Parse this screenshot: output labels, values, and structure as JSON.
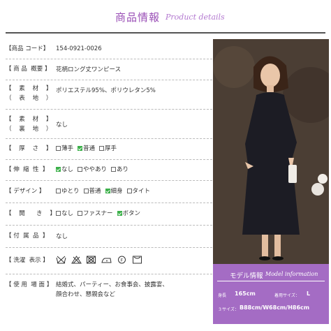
{
  "header": {
    "title": "商品情報",
    "subtitle": "Product details"
  },
  "rows": [
    {
      "label": "【商品 コード】",
      "value": "154-0921-0026"
    },
    {
      "label": "【 商 品  概要 】",
      "value": "花柄ロング丈ワンピース"
    },
    {
      "label": "【    素    材    】",
      "label2": "（    表    地    ）",
      "value": "ポリエステル95%、ポリウレタン5%"
    },
    {
      "label": "【    素    材    】",
      "label2": "（    裏    地    ）",
      "value": "なし"
    },
    {
      "label": "【    厚    さ    】",
      "options": [
        {
          "text": "薄手",
          "on": false
        },
        {
          "text": "普通",
          "on": true
        },
        {
          "text": "厚手",
          "on": false
        }
      ]
    },
    {
      "label": "【 伸  縮  性  】",
      "options": [
        {
          "text": "なし",
          "on": true
        },
        {
          "text": "ややあり",
          "on": false
        },
        {
          "text": "あり",
          "on": false
        }
      ]
    },
    {
      "label": "【 デザイン 】",
      "options": [
        {
          "text": "ゆとり",
          "on": false
        },
        {
          "text": "普通",
          "on": false
        },
        {
          "text": "細身",
          "on": true
        },
        {
          "text": "タイト",
          "on": false
        }
      ]
    },
    {
      "label": "【    開      き    】",
      "options": [
        {
          "text": "なし",
          "on": false
        },
        {
          "text": "ファスナー",
          "on": false
        },
        {
          "text": "ボタン",
          "on": true
        }
      ]
    },
    {
      "label": "【 付  属  品  】",
      "value": "なし"
    },
    {
      "label": "【 洗濯  表示 】",
      "icons": [
        "no-wash-icon",
        "no-bleach-icon",
        "no-tumble-dry-icon",
        "iron-low-icon",
        "dry-clean-icon",
        "hang-dry-icon"
      ]
    },
    {
      "label": "【 使 用  場 面 】",
      "value": "結婚式、パーティー、お食事会、披露宴、",
      "value2": "顔合わせ、懇親会など"
    }
  ],
  "model": {
    "title": "モデル情報",
    "subtitle": "Model information",
    "height_label": "身長",
    "height_value": "165cm",
    "size_label": "着用サイズ：",
    "size_value": "L",
    "three_label": "３サイズ：",
    "three_value": "B88cm/W68cm/H86cm"
  },
  "colors": {
    "accent": "#a46cc4",
    "title": "#9a4fb6",
    "check": "#3cb04a"
  }
}
